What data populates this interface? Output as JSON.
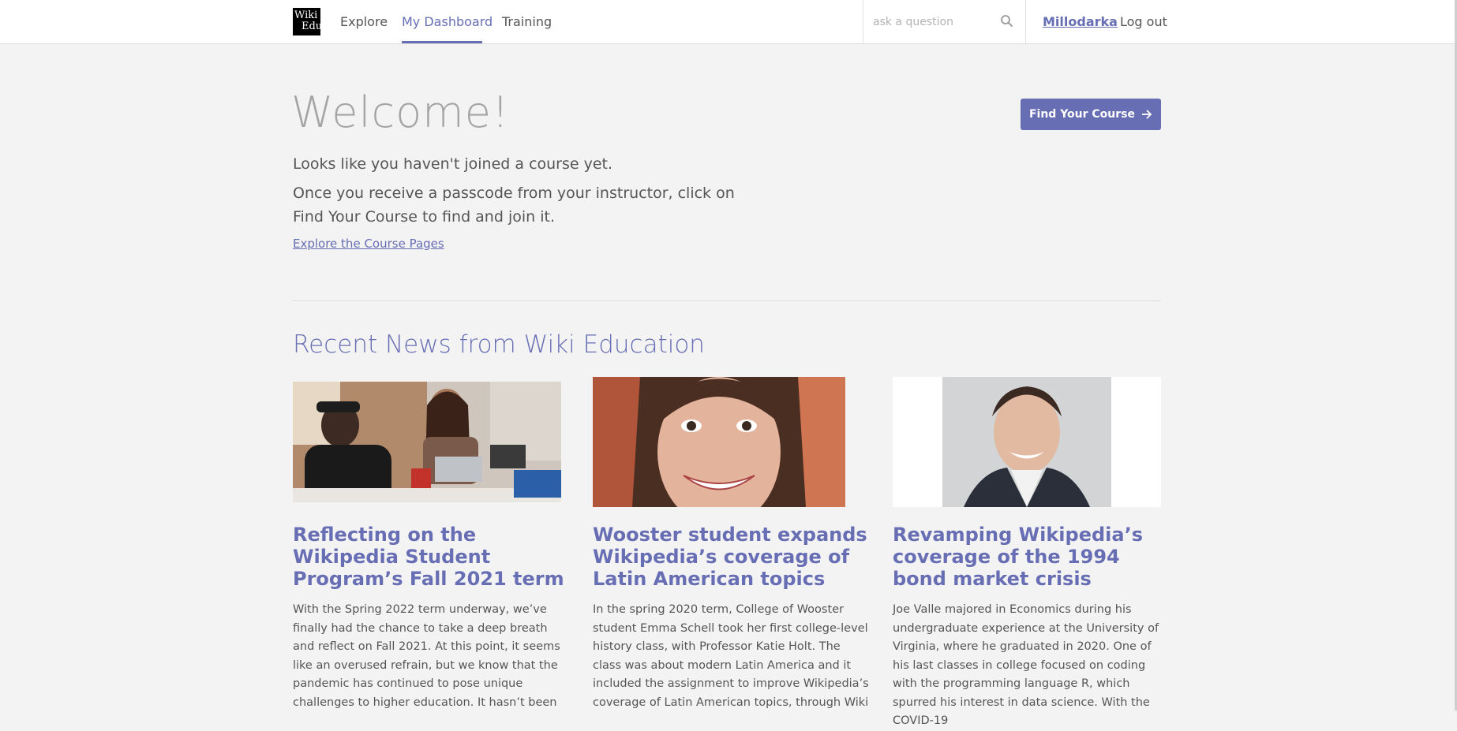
{
  "header": {
    "logo_line1": "Wiki",
    "logo_line2": "Edu",
    "nav": [
      {
        "label": "Explore"
      },
      {
        "label": "My Dashboard"
      },
      {
        "label": "Training"
      }
    ],
    "search_placeholder": "ask a question",
    "user": "Millodarka",
    "logout": "Log out"
  },
  "welcome": {
    "title": "Welcome!",
    "line1": "Looks like you haven't joined a course yet.",
    "line2": "Once you receive a passcode from your instructor, click on Find Your Course to find and join it.",
    "explore_link": "Explore the Course Pages",
    "find_button": "Find Your Course"
  },
  "news": {
    "heading": "Recent News from Wiki Education",
    "items": [
      {
        "title": "Reflecting on the Wikipedia Student Program’s Fall 2021 term",
        "excerpt": "With the Spring 2022 term underway, we’ve finally had the chance to take a deep breath and reflect on Fall 2021. At this point, it seems like an overused refrain, but we know that the pandemic has continued to pose unique challenges to higher education. It hasn’t been"
      },
      {
        "title": "Wooster student expands Wikipedia’s coverage of Latin American topics",
        "excerpt": "In the spring 2020 term, College of Wooster student Emma Schell took her first college-level history class, with Professor Katie Holt. The class was about modern Latin America and it included the assignment to improve Wikipedia’s coverage of Latin American topics, through Wiki"
      },
      {
        "title": "Revamping Wikipedia’s coverage of the 1994 bond market crisis",
        "excerpt": "Joe Valle majored in Economics during his undergraduate experience at the University of Virginia, where he graduated in 2020. One of his last classes in college focused on coding with the programming language R, which spurred his interest in data science. With the COVID-19"
      }
    ]
  },
  "colors": {
    "accent": "#676eb4",
    "background": "#f3f3f3"
  },
  "icons": {
    "search": "search-icon",
    "arrow": "arrow-right-icon"
  }
}
